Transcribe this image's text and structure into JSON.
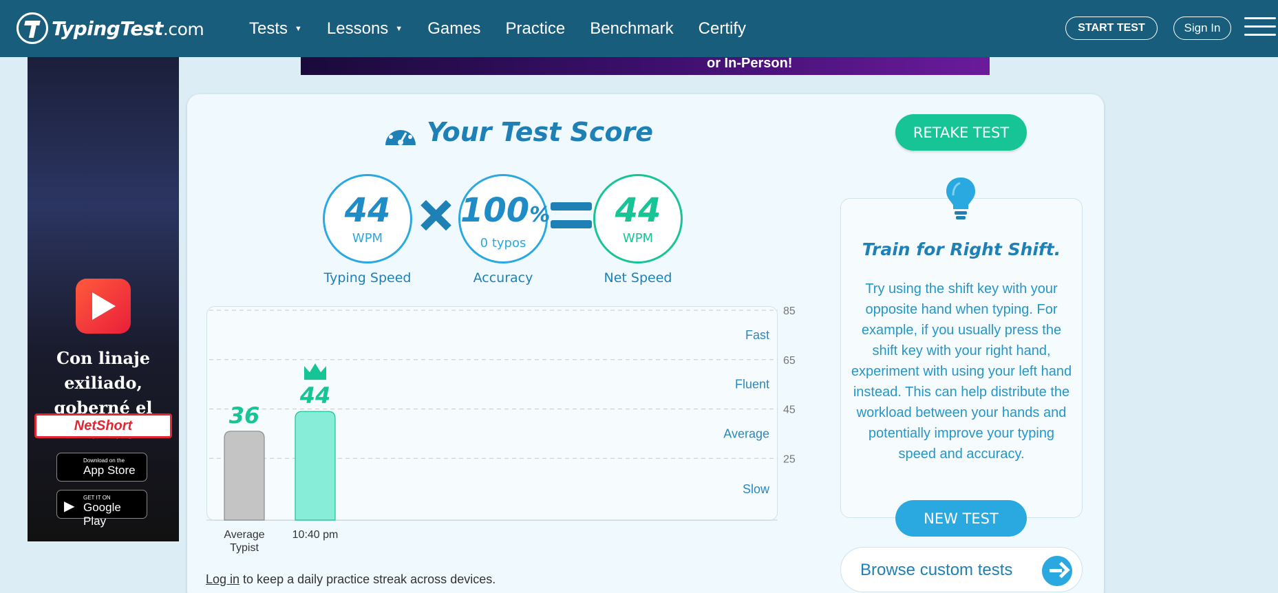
{
  "header": {
    "logo_text": "TypingTest",
    "logo_domain": ".com",
    "nav": [
      {
        "label": "Tests",
        "dropdown": true
      },
      {
        "label": "Lessons",
        "dropdown": true
      },
      {
        "label": "Games",
        "dropdown": false
      },
      {
        "label": "Practice",
        "dropdown": false
      },
      {
        "label": "Benchmark",
        "dropdown": false
      },
      {
        "label": "Certify",
        "dropdown": false
      }
    ],
    "start_test": "START TEST",
    "sign_in": "Sign In"
  },
  "ads": {
    "top_text": "or In-Person!",
    "left_slogan": "Con linaje exiliado, goberné el mundo",
    "left_brand": "NetShort",
    "app_store_small": "Download on the",
    "app_store": "App Store",
    "google_play_small": "GET IT ON",
    "google_play": "Google Play"
  },
  "score": {
    "title": "Your Test Score",
    "speed": {
      "value": "44",
      "unit": "WPM",
      "caption": "Typing Speed"
    },
    "accuracy": {
      "value": "100",
      "unit": "%",
      "sub": "0 typos",
      "caption": "Accuracy"
    },
    "net": {
      "value": "44",
      "unit": "WPM",
      "caption": "Net Speed"
    }
  },
  "chart_data": {
    "type": "bar",
    "categories": [
      "Average Typist",
      "10:40 pm"
    ],
    "values": [
      36,
      44
    ],
    "ylim": [
      0,
      85
    ],
    "y_ticks": [
      25,
      45,
      65,
      85
    ],
    "zones": [
      {
        "label": "Slow",
        "from": 0,
        "to": 25
      },
      {
        "label": "Average",
        "from": 25,
        "to": 45
      },
      {
        "label": "Fluent",
        "from": 45,
        "to": 65
      },
      {
        "label": "Fast",
        "from": 65,
        "to": 85
      }
    ],
    "highlight_index": 1,
    "colors": {
      "average": "#c4c4c4",
      "user": "#87ecd8",
      "value_text": "#17c496"
    }
  },
  "practice_note": {
    "link": "Log in",
    "text": " to keep a daily practice streak across devices."
  },
  "actions": {
    "retake": "RETAKE TEST",
    "new_test": "NEW TEST",
    "browse": "Browse custom tests"
  },
  "tip": {
    "title": "Train for Right Shift.",
    "body": "Try using the shift key with your opposite hand when typing. For example, if you usually press the shift key with your right hand, experiment with using your left hand instead. This can help distribute the workload between your hands and potentially improve your typing speed and accuracy."
  }
}
